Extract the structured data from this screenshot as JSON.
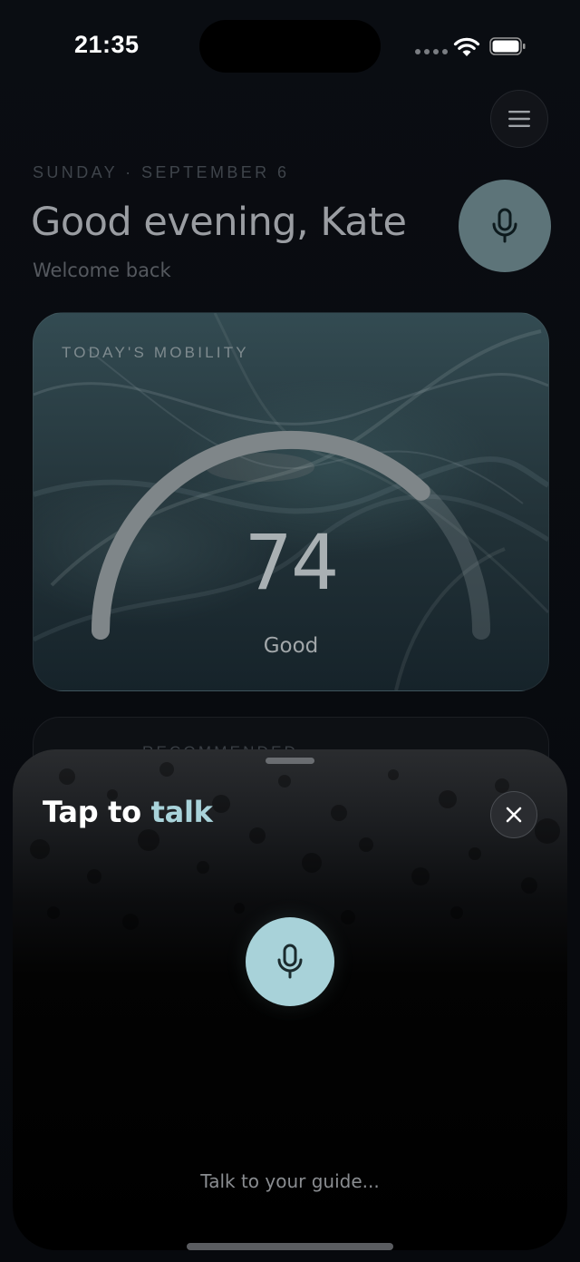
{
  "status_bar": {
    "time": "21:35"
  },
  "home": {
    "date": "SUNDAY · SEPTEMBER 6",
    "greeting": "Good evening, Kate",
    "subtitle": "Welcome back",
    "mobility_card": {
      "label": "TODAY'S MOBILITY",
      "score": "74",
      "score_fraction": 0.74,
      "rating": "Good"
    },
    "recommended_card": {
      "label": "RECOMMENDED"
    }
  },
  "talk_sheet": {
    "title_prefix": "Tap to ",
    "title_accent": "talk",
    "hint": "Talk to your guide..."
  },
  "icons": {
    "menu": "hamburger-menu-icon",
    "mic": "microphone-icon",
    "close": "close-icon"
  },
  "colors": {
    "accent": "#a9d3da",
    "mic_fab": "#5d7479",
    "background": "#07090d"
  }
}
